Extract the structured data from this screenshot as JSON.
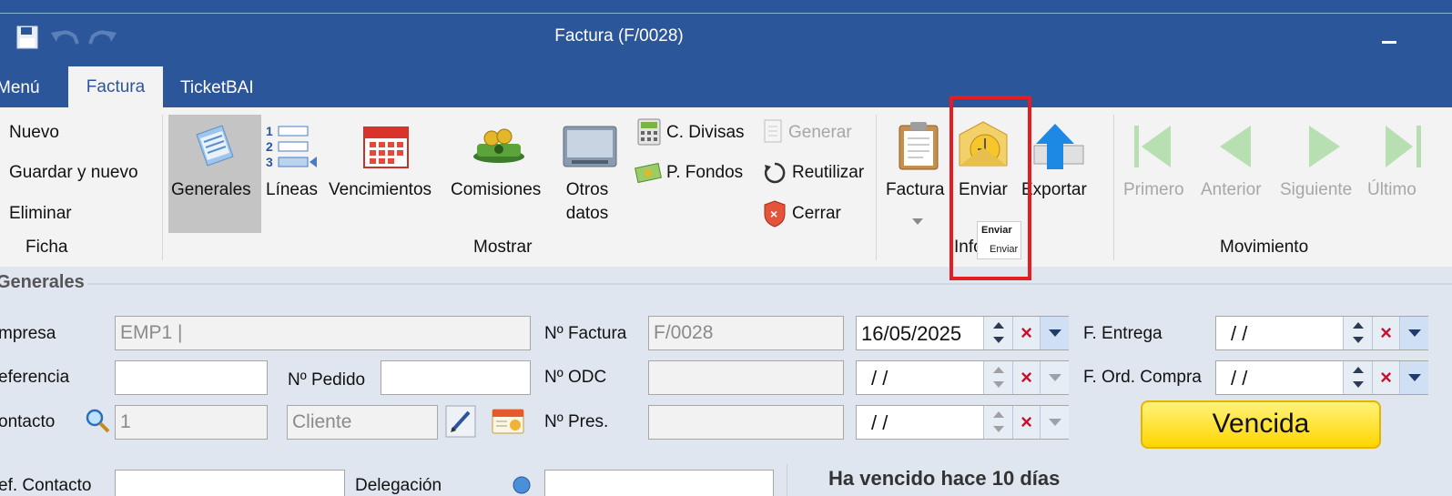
{
  "window": {
    "title": "Factura (F/0028)"
  },
  "quick_access": {
    "save_icon": "save-icon",
    "undo_icon": "undo-icon",
    "redo_icon": "redo-icon"
  },
  "tabs": [
    {
      "label": "Menú"
    },
    {
      "label": "Factura",
      "active": true
    },
    {
      "label": "TicketBAI"
    }
  ],
  "ribbon": {
    "ficha": {
      "group_label": "Ficha",
      "items": [
        "Nuevo",
        "Guardar y nuevo",
        "Eliminar"
      ]
    },
    "mostrar": {
      "group_label": "Mostrar",
      "large": [
        "Generales",
        "Líneas",
        "Vencimientos",
        "Comisiones"
      ],
      "otros_line1": "Otros",
      "otros_line2": "datos",
      "small_col1": [
        "C. Divisas",
        "P. Fondos"
      ],
      "small_col2": [
        "Generar",
        "Reutilizar",
        "Cerrar"
      ]
    },
    "informes": {
      "group_label": "Info",
      "items": [
        "Factura",
        "Enviar",
        "Exportar"
      ]
    },
    "tooltip": {
      "title": "Enviar",
      "body": "Enviar"
    },
    "movimiento": {
      "group_label": "Movimiento",
      "items": [
        "Primero",
        "Anterior",
        "Siguiente",
        "Último"
      ]
    }
  },
  "form": {
    "section_title": "Generales",
    "empresa_label": "mpresa",
    "empresa_value": "EMP1 |",
    "referencia_label": "eferencia",
    "pedido_label": "Nº Pedido",
    "contacto_label": "ontacto",
    "contacto_value": "1",
    "cliente_placeholder": "Cliente",
    "nfactura_label": "Nº Factura",
    "nfactura_value": "F/0028",
    "nodc_label": "Nº ODC",
    "npres_label": "Nº Pres.",
    "fecha_factura": "16/05/2025",
    "fecha_odc": " /  /",
    "fecha_pres": " /  /",
    "entrega_label": "F. Entrega",
    "entrega_value": " /  /",
    "ordcompra_label": "F. Ord. Compra",
    "ordcompra_value": " /  /",
    "status": "Vencida",
    "ref_contacto_label": "ef. Contacto",
    "delegacion_label": "Delegación",
    "overdue_text": "Ha vencido hace 10 días"
  },
  "colors": {
    "titlebar": "#2b579a",
    "highlight": "#e51d23",
    "status": "#ffd600"
  }
}
